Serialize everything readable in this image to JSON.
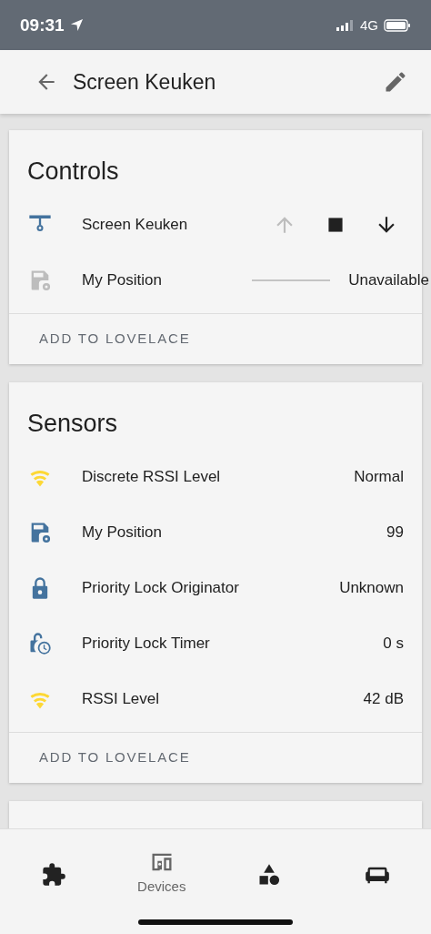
{
  "status_bar": {
    "time": "09:31",
    "network": "4G"
  },
  "app_bar": {
    "title": "Screen Keuken"
  },
  "cards": [
    {
      "title": "Controls",
      "rows": [
        {
          "kind": "cover",
          "name": "Screen Keuken",
          "buttons": [
            {
              "disabled": true
            },
            {
              "disabled": false
            },
            {
              "disabled": false
            }
          ]
        },
        {
          "kind": "slider",
          "name": "My Position",
          "disabled": true,
          "value": "Unavailable"
        }
      ],
      "action": "ADD TO LOVELACE"
    },
    {
      "title": "Sensors",
      "rows": [
        {
          "kind": "sensor",
          "name": "Discrete RSSI Level",
          "value": "Normal"
        },
        {
          "kind": "sensor",
          "name": "My Position",
          "value": "99"
        },
        {
          "kind": "sensor",
          "name": "Priority Lock Originator",
          "value": "Unknown"
        },
        {
          "kind": "sensor",
          "name": "Priority Lock Timer",
          "value": "0 s"
        },
        {
          "kind": "sensor",
          "name": "RSSI Level",
          "value": "42 dB"
        }
      ],
      "action": "ADD TO LOVELACE"
    }
  ],
  "nav": [
    {
      "selected": false
    },
    {
      "label": "Devices",
      "selected": true
    },
    {
      "selected": false
    },
    {
      "selected": false
    }
  ]
}
